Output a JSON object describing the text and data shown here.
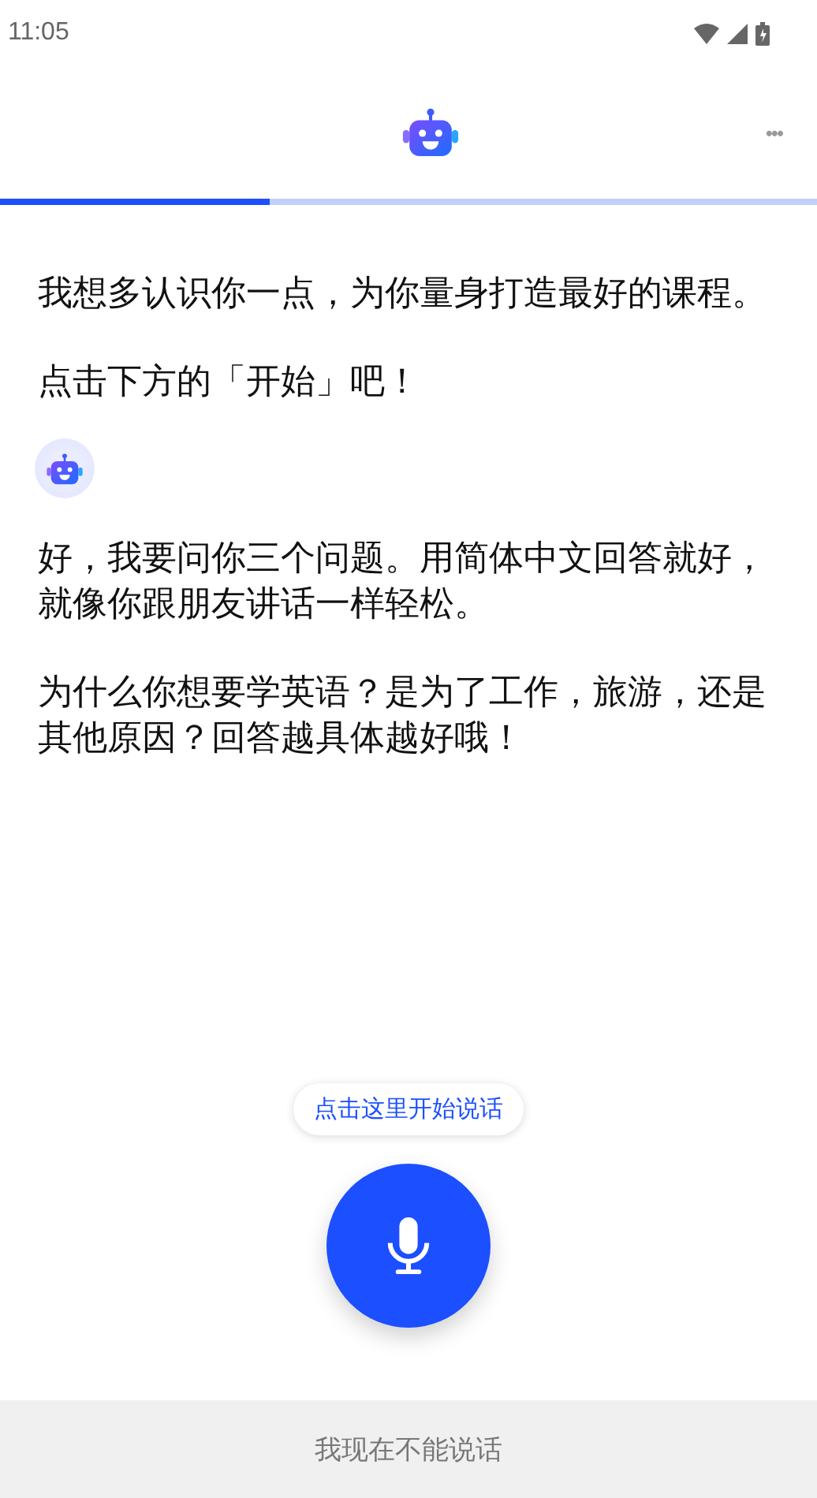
{
  "status_bar": {
    "time": "11:05"
  },
  "header": {
    "menu": "•••",
    "progress": {
      "level": 0.33
    }
  },
  "messages": [
    {
      "show_avatar": false,
      "paragraphs": [
        "我想多认识你一点，为你量身打造最好的课程。",
        "点击下方的「开始」吧！"
      ]
    },
    {
      "show_avatar": true,
      "paragraphs": [
        "好，我要问你三个问题。用简体中文回答就好，就像你跟朋友讲话一样轻松。",
        "为什么你想要学英语？是为了工作，旅游，还是其他原因？回答越具体越好哦！"
      ]
    }
  ],
  "tooltip": "点击这里开始说话",
  "bottom_button": "我现在不能说话"
}
